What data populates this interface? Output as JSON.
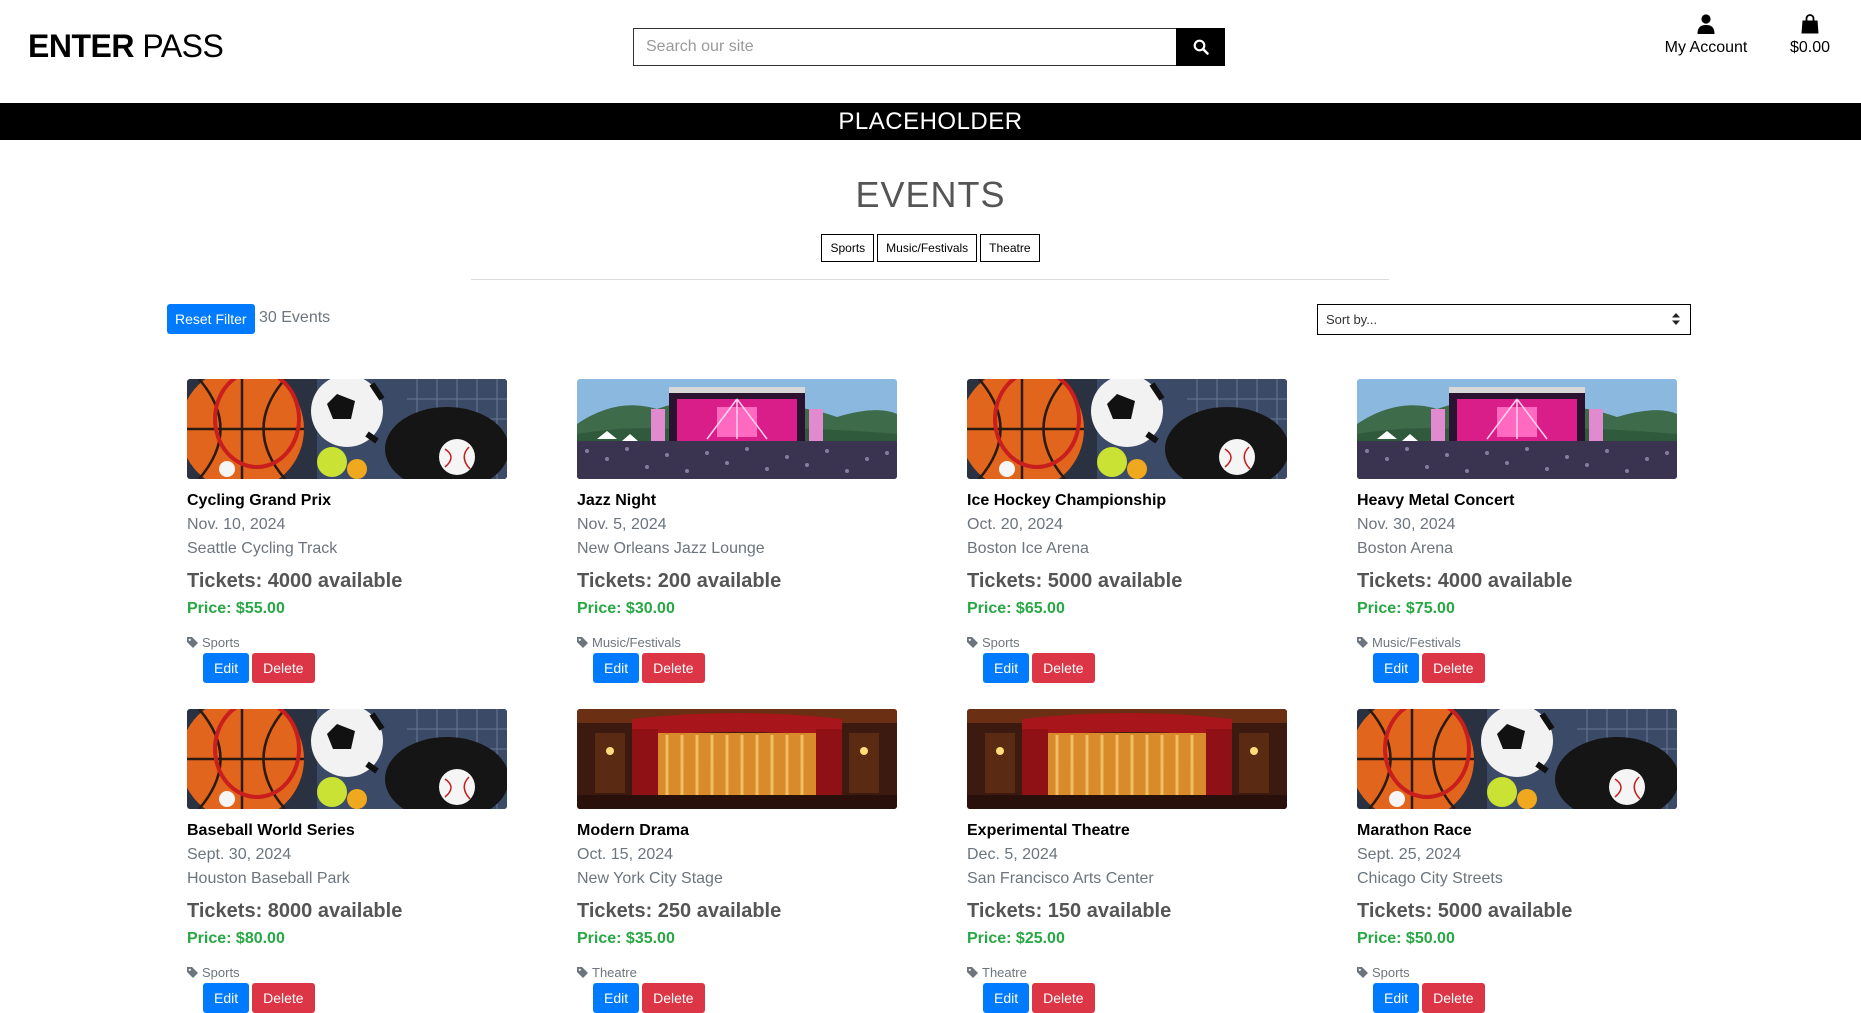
{
  "header": {
    "logo_bold": "ENTER",
    "logo_light": " PASS",
    "search_placeholder": "Search our site",
    "account_label": "My Account",
    "cart_total": "$0.00"
  },
  "banner": {
    "text": "PLACEHOLDER"
  },
  "events": {
    "title": "EVENTS",
    "filters": [
      "Sports",
      "Music/Festivals",
      "Theatre"
    ],
    "reset_label": "Reset Filter",
    "count_label": "30 Events",
    "sort_label": "Sort by..."
  },
  "cards": [
    {
      "name": "Cycling Grand Prix",
      "date": "Nov. 10, 2024",
      "venue": "Seattle Cycling Track",
      "tickets": "Tickets: 4000 available",
      "price": "Price: $55.00",
      "category": "Sports",
      "image": "sports",
      "edit": "Edit",
      "delete": "Delete"
    },
    {
      "name": "Jazz Night",
      "date": "Nov. 5, 2024",
      "venue": "New Orleans Jazz Lounge",
      "tickets": "Tickets: 200 available",
      "price": "Price: $30.00",
      "category": "Music/Festivals",
      "image": "concert",
      "edit": "Edit",
      "delete": "Delete"
    },
    {
      "name": "Ice Hockey Championship",
      "date": "Oct. 20, 2024",
      "venue": "Boston Ice Arena",
      "tickets": "Tickets: 5000 available",
      "price": "Price: $65.00",
      "category": "Sports",
      "image": "sports",
      "edit": "Edit",
      "delete": "Delete"
    },
    {
      "name": "Heavy Metal Concert",
      "date": "Nov. 30, 2024",
      "venue": "Boston Arena",
      "tickets": "Tickets: 4000 available",
      "price": "Price: $75.00",
      "category": "Music/Festivals",
      "image": "concert",
      "edit": "Edit",
      "delete": "Delete"
    },
    {
      "name": "Baseball World Series",
      "date": "Sept. 30, 2024",
      "venue": "Houston Baseball Park",
      "tickets": "Tickets: 8000 available",
      "price": "Price: $80.00",
      "category": "Sports",
      "image": "sports",
      "edit": "Edit",
      "delete": "Delete"
    },
    {
      "name": "Modern Drama",
      "date": "Oct. 15, 2024",
      "venue": "New York City Stage",
      "tickets": "Tickets: 250 available",
      "price": "Price: $35.00",
      "category": "Theatre",
      "image": "theatre",
      "edit": "Edit",
      "delete": "Delete"
    },
    {
      "name": "Experimental Theatre",
      "date": "Dec. 5, 2024",
      "venue": "San Francisco Arts Center",
      "tickets": "Tickets: 150 available",
      "price": "Price: $25.00",
      "category": "Theatre",
      "image": "theatre",
      "edit": "Edit",
      "delete": "Delete"
    },
    {
      "name": "Marathon Race",
      "date": "Sept. 25, 2024",
      "venue": "Chicago City Streets",
      "tickets": "Tickets: 5000 available",
      "price": "Price: $50.00",
      "category": "Sports",
      "image": "sports",
      "edit": "Edit",
      "delete": "Delete"
    }
  ],
  "colors": {
    "primary": "#007bff",
    "danger": "#dc3545",
    "price": "#28a745",
    "banner": "#000000"
  }
}
